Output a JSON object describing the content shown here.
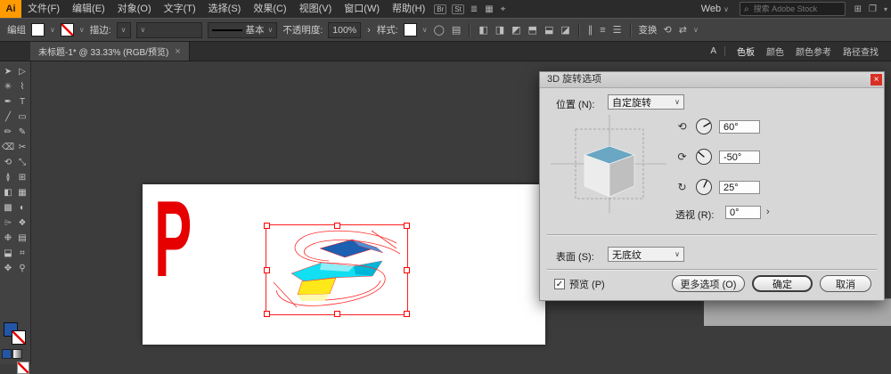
{
  "app_logo": "Ai",
  "menubar": {
    "items": [
      "文件(F)",
      "编辑(E)",
      "对象(O)",
      "文字(T)",
      "选择(S)",
      "效果(C)",
      "视图(V)",
      "窗口(W)",
      "帮助(H)"
    ],
    "badge_bridge": "Br",
    "badge_stock": "St",
    "workspace": "Web",
    "search_placeholder": "搜索 Adobe Stock"
  },
  "controlbar": {
    "selection_label": "编组",
    "stroke_label": "描边:",
    "brush_value": "基本",
    "opacity_label": "不透明度:",
    "opacity_value": "100%",
    "style_label": "样式:",
    "transform_label": "变换",
    "align_icons": [
      "◧",
      "◨",
      "◩",
      "⬒",
      "⬓",
      "◪"
    ],
    "distribute_icons": [
      "∥",
      "≡",
      "☰"
    ]
  },
  "tabbar": {
    "doc_title": "未标题-1* @ 33.33% (RGB/预览)"
  },
  "right_dock": {
    "collapsed_letter": "A",
    "panel_tabs": [
      "色板",
      "颜色",
      "颜色参考",
      "路径查找"
    ]
  },
  "artboard": {
    "letter": "P"
  },
  "dialog": {
    "title": "3D 旋转选项",
    "position_label": "位置 (N):",
    "position_value": "自定旋转",
    "rotation_rows": [
      {
        "name": "x",
        "icon": "⟲",
        "value": "60°",
        "deg": 60
      },
      {
        "name": "y",
        "icon": "⟳",
        "value": "-50°",
        "deg": -50
      },
      {
        "name": "z",
        "icon": "↻",
        "value": "25°",
        "deg": 25
      }
    ],
    "perspective_label": "透视 (R):",
    "perspective_value": "0°",
    "surface_label": "表面 (S):",
    "surface_value": "无底纹",
    "preview_label": "预览 (P)",
    "more_options_label": "更多选项 (O)",
    "ok_label": "确定",
    "cancel_label": "取消"
  },
  "icons": {
    "search": "⌕",
    "caret": "∨",
    "caret_small": "▾",
    "chevron_right": "›",
    "menu": "≣",
    "grid": "▦",
    "target": "⌖",
    "windows": "❐",
    "apps": "⊞",
    "close": "×",
    "check": "✓",
    "circle": "◯",
    "doc": "▤",
    "swap": "⇄",
    "rotate": "⟲"
  },
  "tools": [
    {
      "name": "selection",
      "glyph": "➤"
    },
    {
      "name": "direct-selection",
      "glyph": "▷"
    },
    {
      "name": "magic-wand",
      "glyph": "✳"
    },
    {
      "name": "lasso",
      "glyph": "⌇"
    },
    {
      "name": "pen",
      "glyph": "✒"
    },
    {
      "name": "type",
      "glyph": "T"
    },
    {
      "name": "line-segment",
      "glyph": "╱"
    },
    {
      "name": "rectangle",
      "glyph": "▭"
    },
    {
      "name": "paintbrush",
      "glyph": "✏"
    },
    {
      "name": "pencil",
      "glyph": "✎"
    },
    {
      "name": "eraser",
      "glyph": "⌫"
    },
    {
      "name": "scissors",
      "glyph": "✂"
    },
    {
      "name": "rotate",
      "glyph": "⟲"
    },
    {
      "name": "scale",
      "glyph": "⤡"
    },
    {
      "name": "width",
      "glyph": "≬"
    },
    {
      "name": "free-transform",
      "glyph": "⊞"
    },
    {
      "name": "shape-builder",
      "glyph": "◧"
    },
    {
      "name": "perspective-grid",
      "glyph": "▦"
    },
    {
      "name": "mesh",
      "glyph": "▩"
    },
    {
      "name": "gradient",
      "glyph": "◐"
    },
    {
      "name": "eyedropper",
      "glyph": "⌲"
    },
    {
      "name": "blend",
      "glyph": "❖"
    },
    {
      "name": "symbol-sprayer",
      "glyph": "❉"
    },
    {
      "name": "column-graph",
      "glyph": "▤"
    },
    {
      "name": "artboard",
      "glyph": "⬓"
    },
    {
      "name": "slice",
      "glyph": "⌗"
    },
    {
      "name": "hand",
      "glyph": "✥"
    },
    {
      "name": "zoom",
      "glyph": "⚲"
    }
  ],
  "colors": {
    "accent_red": "#e60000",
    "logo_orange": "#ff9a00",
    "cube_top": "#69a7c2",
    "s_blue": "#1d5fb0",
    "s_cyan": "#12dff2",
    "s_yellow": "#ffe81a"
  }
}
